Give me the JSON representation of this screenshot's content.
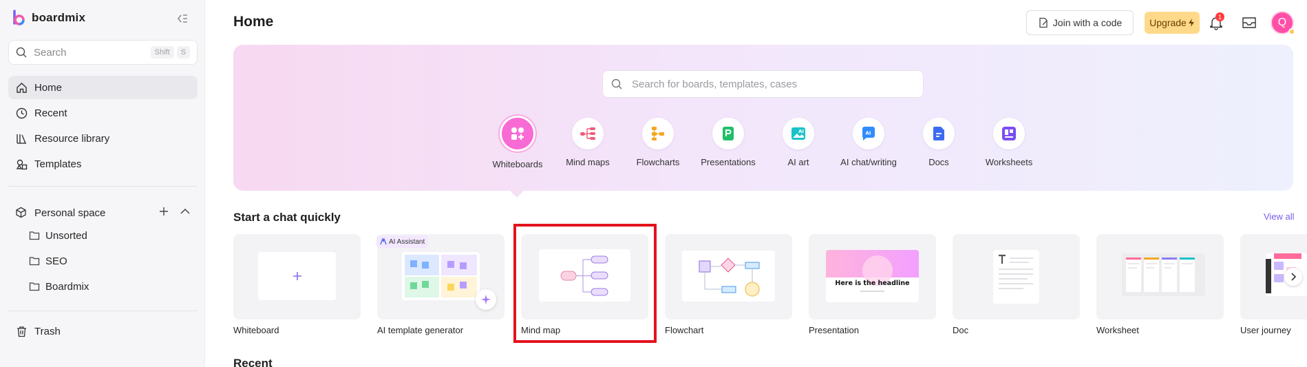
{
  "sidebar": {
    "brand": "boardmix",
    "search": {
      "placeholder": "Search",
      "shortcut": [
        "Shift",
        "S"
      ]
    },
    "nav": [
      {
        "label": "Home",
        "icon": "home-icon",
        "active": true
      },
      {
        "label": "Recent",
        "icon": "clock-icon"
      },
      {
        "label": "Resource library",
        "icon": "library-icon"
      },
      {
        "label": "Templates",
        "icon": "templates-icon"
      }
    ],
    "personal_space": "Personal space",
    "folders": [
      "Unsorted",
      "SEO",
      "Boardmix"
    ],
    "trash": "Trash"
  },
  "header": {
    "title": "Home",
    "join_label": "Join with a code",
    "upgrade_label": "Upgrade",
    "notification_count": "1",
    "avatar_initial": "Q"
  },
  "hero": {
    "search_placeholder": "Search for boards, templates, cases",
    "categories": [
      {
        "label": "Whiteboards",
        "icon": "whiteboards-icon",
        "color": "#f96bd4"
      },
      {
        "label": "Mind maps",
        "icon": "mind-maps-icon",
        "color": "#f25a7a"
      },
      {
        "label": "Flowcharts",
        "icon": "flowcharts-icon",
        "color": "#f5a623"
      },
      {
        "label": "Presentations",
        "icon": "presentations-icon",
        "color": "#1fbf6b"
      },
      {
        "label": "AI art",
        "icon": "ai-art-icon",
        "color": "#19c2c8"
      },
      {
        "label": "AI chat/writing",
        "icon": "ai-chat-icon",
        "color": "#2f8cff"
      },
      {
        "label": "Docs",
        "icon": "docs-icon",
        "color": "#3b6cf0"
      },
      {
        "label": "Worksheets",
        "icon": "worksheets-icon",
        "color": "#7b4df2"
      }
    ]
  },
  "quick": {
    "title": "Start a chat quickly",
    "view_all": "View all",
    "ai_badge": "AI Assistant",
    "presentation_headline": "Here is the headline",
    "cards": [
      "Whiteboard",
      "AI template generator",
      "Mind map",
      "Flowchart",
      "Presentation",
      "Doc",
      "Worksheet",
      "User journey"
    ]
  },
  "recent_title": "Recent"
}
